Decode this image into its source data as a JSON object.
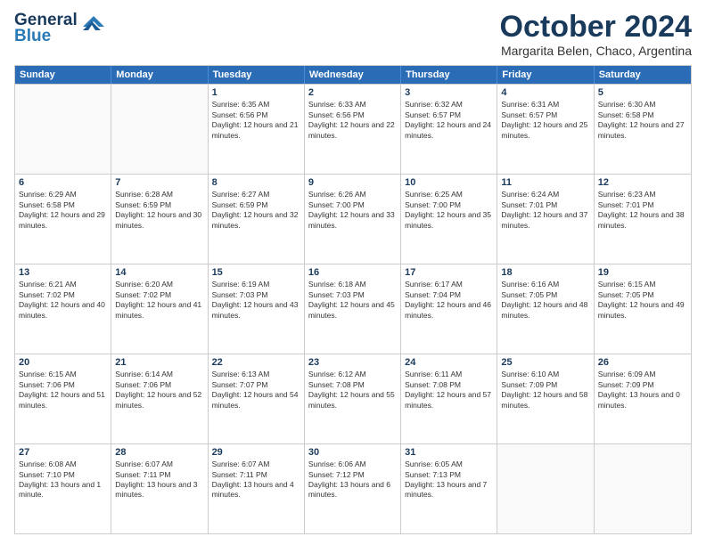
{
  "logo": {
    "general": "General",
    "blue": "Blue"
  },
  "title": "October 2024",
  "subtitle": "Margarita Belen, Chaco, Argentina",
  "header_days": [
    "Sunday",
    "Monday",
    "Tuesday",
    "Wednesday",
    "Thursday",
    "Friday",
    "Saturday"
  ],
  "weeks": [
    [
      {
        "day": "",
        "empty": true
      },
      {
        "day": "",
        "empty": true
      },
      {
        "day": "1",
        "sunrise": "Sunrise: 6:35 AM",
        "sunset": "Sunset: 6:56 PM",
        "daylight": "Daylight: 12 hours and 21 minutes."
      },
      {
        "day": "2",
        "sunrise": "Sunrise: 6:33 AM",
        "sunset": "Sunset: 6:56 PM",
        "daylight": "Daylight: 12 hours and 22 minutes."
      },
      {
        "day": "3",
        "sunrise": "Sunrise: 6:32 AM",
        "sunset": "Sunset: 6:57 PM",
        "daylight": "Daylight: 12 hours and 24 minutes."
      },
      {
        "day": "4",
        "sunrise": "Sunrise: 6:31 AM",
        "sunset": "Sunset: 6:57 PM",
        "daylight": "Daylight: 12 hours and 25 minutes."
      },
      {
        "day": "5",
        "sunrise": "Sunrise: 6:30 AM",
        "sunset": "Sunset: 6:58 PM",
        "daylight": "Daylight: 12 hours and 27 minutes."
      }
    ],
    [
      {
        "day": "6",
        "sunrise": "Sunrise: 6:29 AM",
        "sunset": "Sunset: 6:58 PM",
        "daylight": "Daylight: 12 hours and 29 minutes."
      },
      {
        "day": "7",
        "sunrise": "Sunrise: 6:28 AM",
        "sunset": "Sunset: 6:59 PM",
        "daylight": "Daylight: 12 hours and 30 minutes."
      },
      {
        "day": "8",
        "sunrise": "Sunrise: 6:27 AM",
        "sunset": "Sunset: 6:59 PM",
        "daylight": "Daylight: 12 hours and 32 minutes."
      },
      {
        "day": "9",
        "sunrise": "Sunrise: 6:26 AM",
        "sunset": "Sunset: 7:00 PM",
        "daylight": "Daylight: 12 hours and 33 minutes."
      },
      {
        "day": "10",
        "sunrise": "Sunrise: 6:25 AM",
        "sunset": "Sunset: 7:00 PM",
        "daylight": "Daylight: 12 hours and 35 minutes."
      },
      {
        "day": "11",
        "sunrise": "Sunrise: 6:24 AM",
        "sunset": "Sunset: 7:01 PM",
        "daylight": "Daylight: 12 hours and 37 minutes."
      },
      {
        "day": "12",
        "sunrise": "Sunrise: 6:23 AM",
        "sunset": "Sunset: 7:01 PM",
        "daylight": "Daylight: 12 hours and 38 minutes."
      }
    ],
    [
      {
        "day": "13",
        "sunrise": "Sunrise: 6:21 AM",
        "sunset": "Sunset: 7:02 PM",
        "daylight": "Daylight: 12 hours and 40 minutes."
      },
      {
        "day": "14",
        "sunrise": "Sunrise: 6:20 AM",
        "sunset": "Sunset: 7:02 PM",
        "daylight": "Daylight: 12 hours and 41 minutes."
      },
      {
        "day": "15",
        "sunrise": "Sunrise: 6:19 AM",
        "sunset": "Sunset: 7:03 PM",
        "daylight": "Daylight: 12 hours and 43 minutes."
      },
      {
        "day": "16",
        "sunrise": "Sunrise: 6:18 AM",
        "sunset": "Sunset: 7:03 PM",
        "daylight": "Daylight: 12 hours and 45 minutes."
      },
      {
        "day": "17",
        "sunrise": "Sunrise: 6:17 AM",
        "sunset": "Sunset: 7:04 PM",
        "daylight": "Daylight: 12 hours and 46 minutes."
      },
      {
        "day": "18",
        "sunrise": "Sunrise: 6:16 AM",
        "sunset": "Sunset: 7:05 PM",
        "daylight": "Daylight: 12 hours and 48 minutes."
      },
      {
        "day": "19",
        "sunrise": "Sunrise: 6:15 AM",
        "sunset": "Sunset: 7:05 PM",
        "daylight": "Daylight: 12 hours and 49 minutes."
      }
    ],
    [
      {
        "day": "20",
        "sunrise": "Sunrise: 6:15 AM",
        "sunset": "Sunset: 7:06 PM",
        "daylight": "Daylight: 12 hours and 51 minutes."
      },
      {
        "day": "21",
        "sunrise": "Sunrise: 6:14 AM",
        "sunset": "Sunset: 7:06 PM",
        "daylight": "Daylight: 12 hours and 52 minutes."
      },
      {
        "day": "22",
        "sunrise": "Sunrise: 6:13 AM",
        "sunset": "Sunset: 7:07 PM",
        "daylight": "Daylight: 12 hours and 54 minutes."
      },
      {
        "day": "23",
        "sunrise": "Sunrise: 6:12 AM",
        "sunset": "Sunset: 7:08 PM",
        "daylight": "Daylight: 12 hours and 55 minutes."
      },
      {
        "day": "24",
        "sunrise": "Sunrise: 6:11 AM",
        "sunset": "Sunset: 7:08 PM",
        "daylight": "Daylight: 12 hours and 57 minutes."
      },
      {
        "day": "25",
        "sunrise": "Sunrise: 6:10 AM",
        "sunset": "Sunset: 7:09 PM",
        "daylight": "Daylight: 12 hours and 58 minutes."
      },
      {
        "day": "26",
        "sunrise": "Sunrise: 6:09 AM",
        "sunset": "Sunset: 7:09 PM",
        "daylight": "Daylight: 13 hours and 0 minutes."
      }
    ],
    [
      {
        "day": "27",
        "sunrise": "Sunrise: 6:08 AM",
        "sunset": "Sunset: 7:10 PM",
        "daylight": "Daylight: 13 hours and 1 minute."
      },
      {
        "day": "28",
        "sunrise": "Sunrise: 6:07 AM",
        "sunset": "Sunset: 7:11 PM",
        "daylight": "Daylight: 13 hours and 3 minutes."
      },
      {
        "day": "29",
        "sunrise": "Sunrise: 6:07 AM",
        "sunset": "Sunset: 7:11 PM",
        "daylight": "Daylight: 13 hours and 4 minutes."
      },
      {
        "day": "30",
        "sunrise": "Sunrise: 6:06 AM",
        "sunset": "Sunset: 7:12 PM",
        "daylight": "Daylight: 13 hours and 6 minutes."
      },
      {
        "day": "31",
        "sunrise": "Sunrise: 6:05 AM",
        "sunset": "Sunset: 7:13 PM",
        "daylight": "Daylight: 13 hours and 7 minutes."
      },
      {
        "day": "",
        "empty": true
      },
      {
        "day": "",
        "empty": true
      }
    ]
  ]
}
